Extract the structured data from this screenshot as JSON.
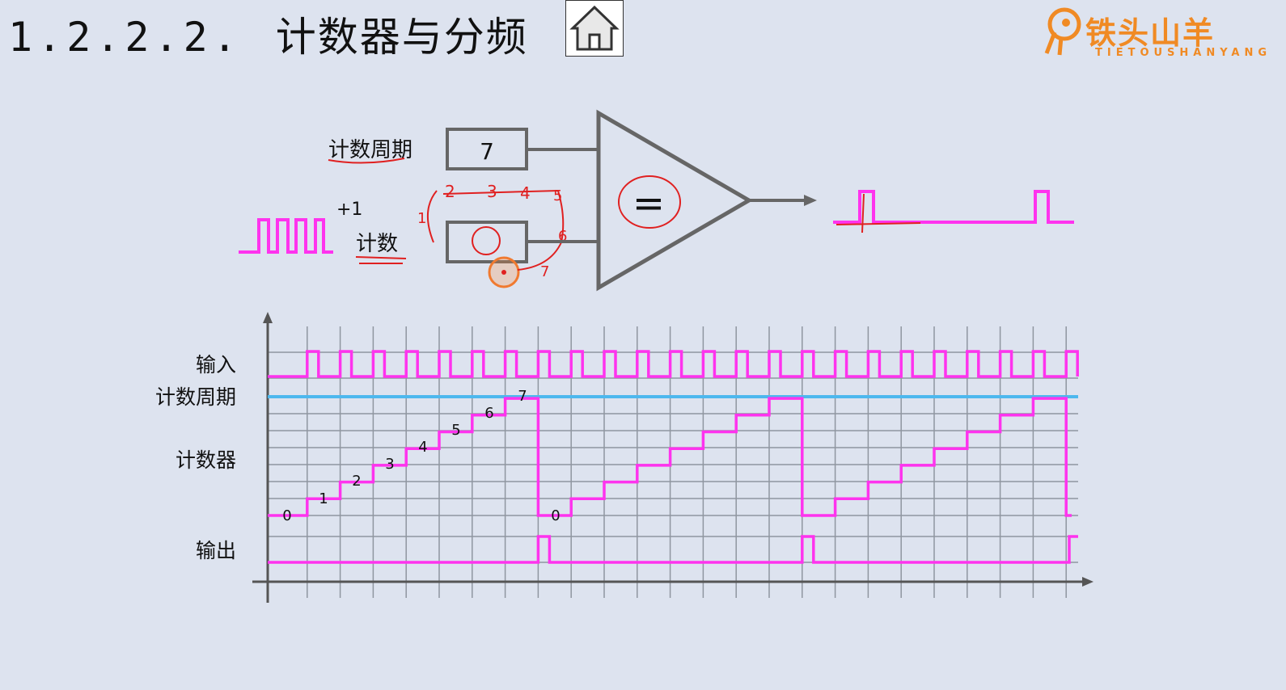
{
  "header": {
    "section_number": "1.2.2.2.",
    "title": "计数器与分频",
    "home_icon": "home-icon"
  },
  "logo": {
    "name": "铁头山羊",
    "subtitle": "TIETOUSHANYANG"
  },
  "block_diagram": {
    "period_label": "计数周期",
    "period_value": "7",
    "counter_label": "计数",
    "increment_label": "+1",
    "comparator_symbol": "=",
    "annotation_sequence": [
      "1",
      "2",
      "3",
      "4",
      "5",
      "6",
      "7"
    ]
  },
  "timing_diagram": {
    "row_labels": {
      "input": "输入",
      "period": "计数周期",
      "counter": "计数器",
      "output": "输出"
    },
    "counter_values": [
      "0",
      "1",
      "2",
      "3",
      "4",
      "5",
      "6",
      "7",
      "0"
    ],
    "colors": {
      "signal": "#ff33ee",
      "period_line": "#4db8ee",
      "grid": "#8f96a0",
      "axis": "#555555"
    }
  }
}
